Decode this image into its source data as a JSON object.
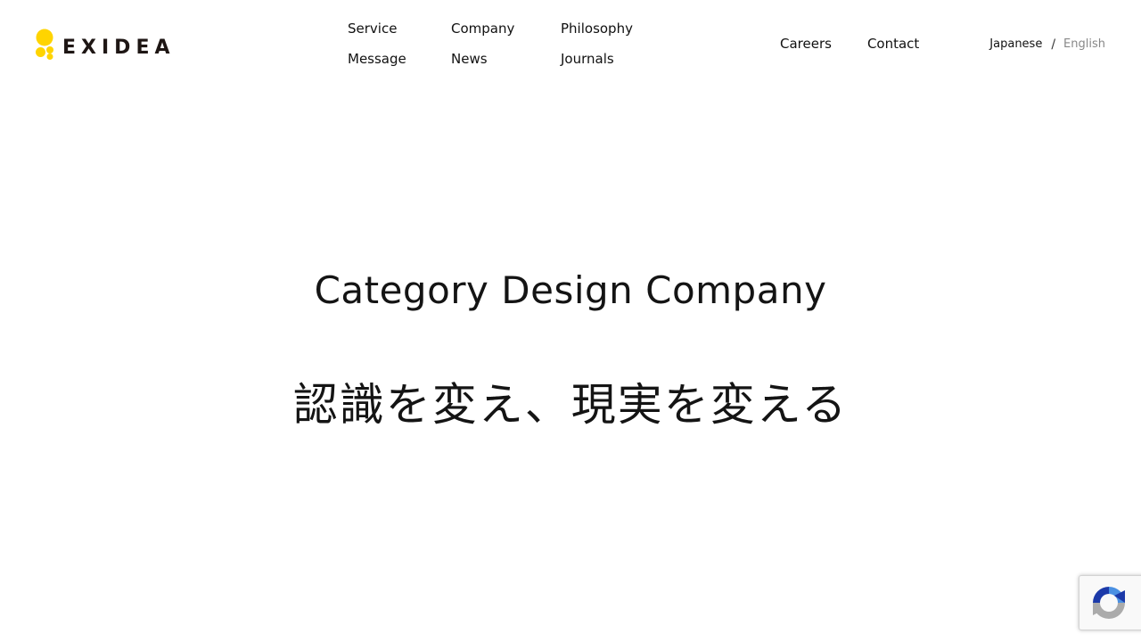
{
  "header": {
    "logo": {
      "text": "EXIDEA",
      "mark_color": "#FFD400",
      "text_color": "#1E1614"
    },
    "nav": [
      {
        "label": "Service"
      },
      {
        "label": "Company"
      },
      {
        "label": "Philosophy"
      },
      {
        "label": "Message"
      },
      {
        "label": "News"
      },
      {
        "label": "Journals"
      }
    ],
    "nav_right": [
      {
        "label": "Careers"
      },
      {
        "label": "Contact"
      }
    ],
    "language": {
      "japanese": "Japanese",
      "separator": "/",
      "english": "English",
      "active": "Japanese"
    }
  },
  "hero": {
    "title": "Category Design Company",
    "subtitle": "認識を変え、現実を変える"
  },
  "recaptcha": {
    "icon": "recaptcha-icon",
    "colors": {
      "blue": "#4A90E2",
      "navy": "#1C3AA9",
      "gray": "#ABABAB"
    }
  }
}
